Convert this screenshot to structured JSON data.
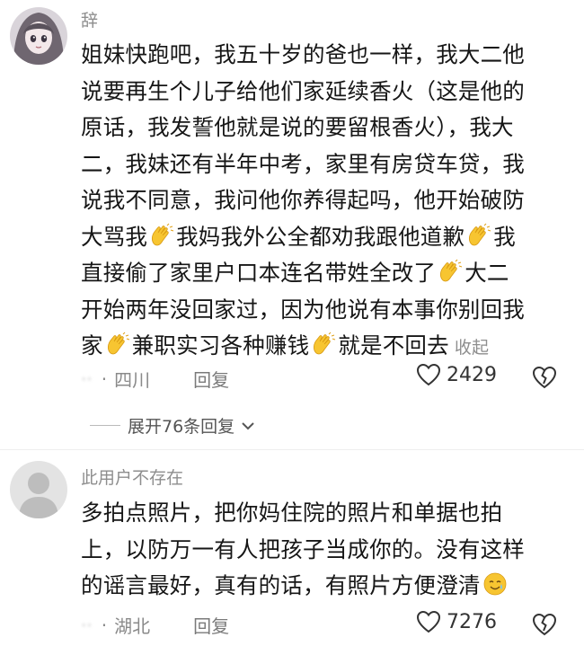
{
  "comment1": {
    "username": "辞",
    "paragraph": [
      "姐妹快跑吧，我五十岁的爸也一样，我大二他",
      "说要再生个儿子给他们家延续香火（这是他的",
      "原话，我发誓他就是说的要留根香火），我大",
      "二，我妹还有半年中考，家里有房贷车贷，我",
      "说我不同意，我问他你养得起吗，他开始破防"
    ],
    "line6_a": "大骂我",
    "line6_b": "我妈我外公全都劝我跟他道歉",
    "line6_c": "我",
    "line7_a": "直接偷了家里户口本连名带姓全改了",
    "line7_b": "大二",
    "line8": "开始两年没回家过，因为他说有本事你别回我",
    "line9_a": "家",
    "line9_b": "兼职实习各种赚钱",
    "line9_c": "就是不回去",
    "collapse": "收起",
    "blurred_time": "··",
    "location": "四川",
    "reply": "回复",
    "likes": "2429",
    "expand": "展开76条回复"
  },
  "comment2": {
    "username": "此用户不存在",
    "lines": [
      "多拍点照片，把你妈住院的照片和单据也拍",
      "上，以防万一有人把孩子当成你的。没有这样"
    ],
    "line3": "的谣言最好，真有的话，有照片方便澄清",
    "blurred_time": "··",
    "location": "湖北",
    "reply": "回复",
    "likes": "7276"
  },
  "icons": {
    "clap": "clapping-hands-emoji",
    "smile": "smiling-face-with-tear-emoji",
    "like": "heart-outline-icon",
    "dislike": "broken-heart-icon",
    "chevron": "chevron-down-icon"
  },
  "colors": {
    "text": "#161616",
    "secondary": "#8e8e8e",
    "emoji": "#f7c531"
  }
}
